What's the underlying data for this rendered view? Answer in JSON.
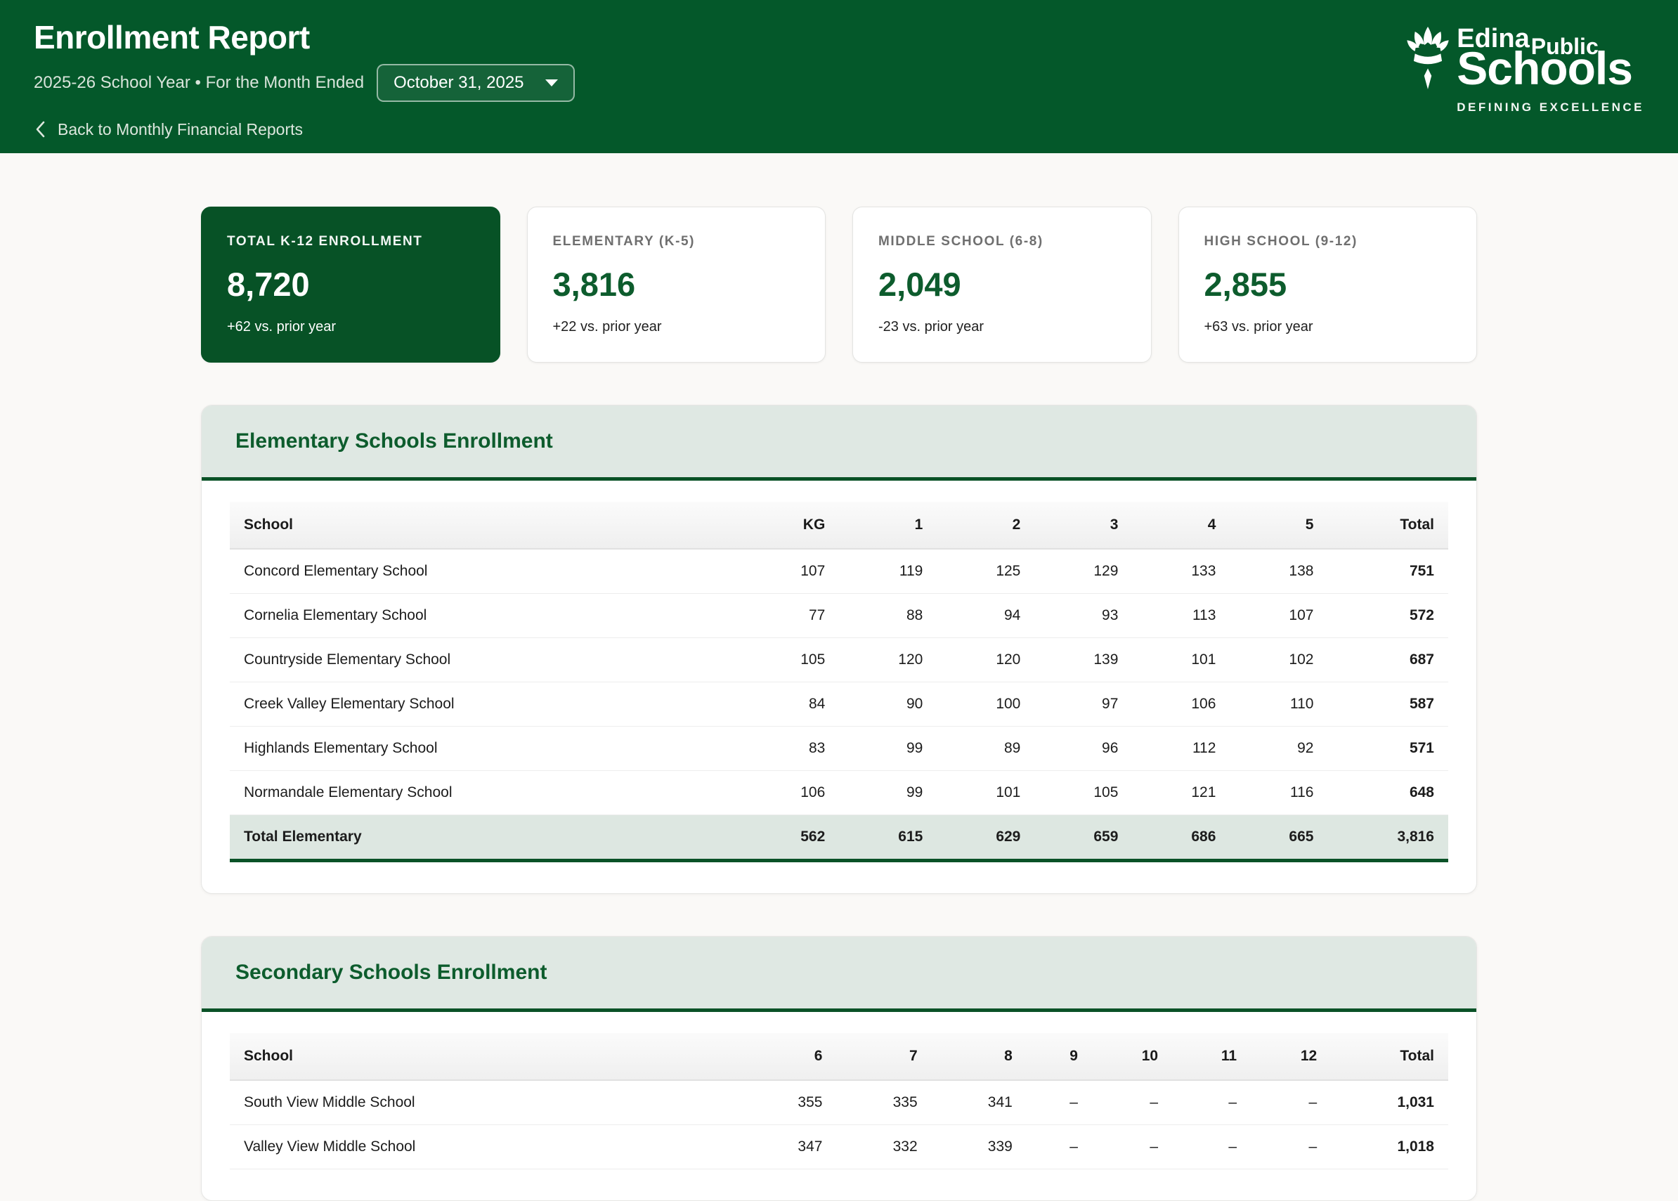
{
  "colors": {
    "brand_green": "#04582a",
    "card_green": "#075226",
    "accent_green": "#0d5c2d",
    "section_header_bg": "#dfe8e3",
    "total_row_bg": "#dde7e1",
    "page_bg": "#faf9f7"
  },
  "header": {
    "title": "Enrollment Report",
    "subtitle": "2025-26 School Year • For the Month Ended",
    "month_selected": "October 31, 2025",
    "back_label": "Back to Monthly Financial Reports",
    "logo": {
      "word1": "Edina",
      "word2": "Public",
      "word3": "Schools",
      "tagline": "DEFINING EXCELLENCE"
    }
  },
  "summary_cards": [
    {
      "label": "TOTAL K-12 ENROLLMENT",
      "value": "8,720",
      "delta": "+62 vs. prior year"
    },
    {
      "label": "ELEMENTARY (K-5)",
      "value": "3,816",
      "delta": "+22 vs. prior year"
    },
    {
      "label": "MIDDLE SCHOOL (6-8)",
      "value": "2,049",
      "delta": "-23 vs. prior year"
    },
    {
      "label": "HIGH SCHOOL (9-12)",
      "value": "2,855",
      "delta": "+63 vs. prior year"
    }
  ],
  "elementary_table": {
    "title": "Elementary Schools Enrollment",
    "columns": [
      "School",
      "KG",
      "1",
      "2",
      "3",
      "4",
      "5",
      "Total"
    ],
    "rows": [
      {
        "school": "Concord Elementary School",
        "values": [
          "107",
          "119",
          "125",
          "129",
          "133",
          "138",
          "751"
        ]
      },
      {
        "school": "Cornelia Elementary School",
        "values": [
          "77",
          "88",
          "94",
          "93",
          "113",
          "107",
          "572"
        ]
      },
      {
        "school": "Countryside Elementary School",
        "values": [
          "105",
          "120",
          "120",
          "139",
          "101",
          "102",
          "687"
        ]
      },
      {
        "school": "Creek Valley Elementary School",
        "values": [
          "84",
          "90",
          "100",
          "97",
          "106",
          "110",
          "587"
        ]
      },
      {
        "school": "Highlands Elementary School",
        "values": [
          "83",
          "99",
          "89",
          "96",
          "112",
          "92",
          "571"
        ]
      },
      {
        "school": "Normandale Elementary School",
        "values": [
          "106",
          "99",
          "101",
          "105",
          "121",
          "116",
          "648"
        ]
      },
      {
        "school": "Total Elementary",
        "is_total": true,
        "values": [
          "562",
          "615",
          "629",
          "659",
          "686",
          "665",
          "3,816"
        ]
      }
    ]
  },
  "secondary_table": {
    "title": "Secondary Schools Enrollment",
    "columns": [
      "School",
      "6",
      "7",
      "8",
      "9",
      "10",
      "11",
      "12",
      "Total"
    ],
    "rows": [
      {
        "school": "South View Middle School",
        "values": [
          "355",
          "335",
          "341",
          "–",
          "–",
          "–",
          "–",
          "1,031"
        ]
      },
      {
        "school": "Valley View Middle School",
        "values": [
          "347",
          "332",
          "339",
          "–",
          "–",
          "–",
          "–",
          "1,018"
        ]
      }
    ]
  }
}
